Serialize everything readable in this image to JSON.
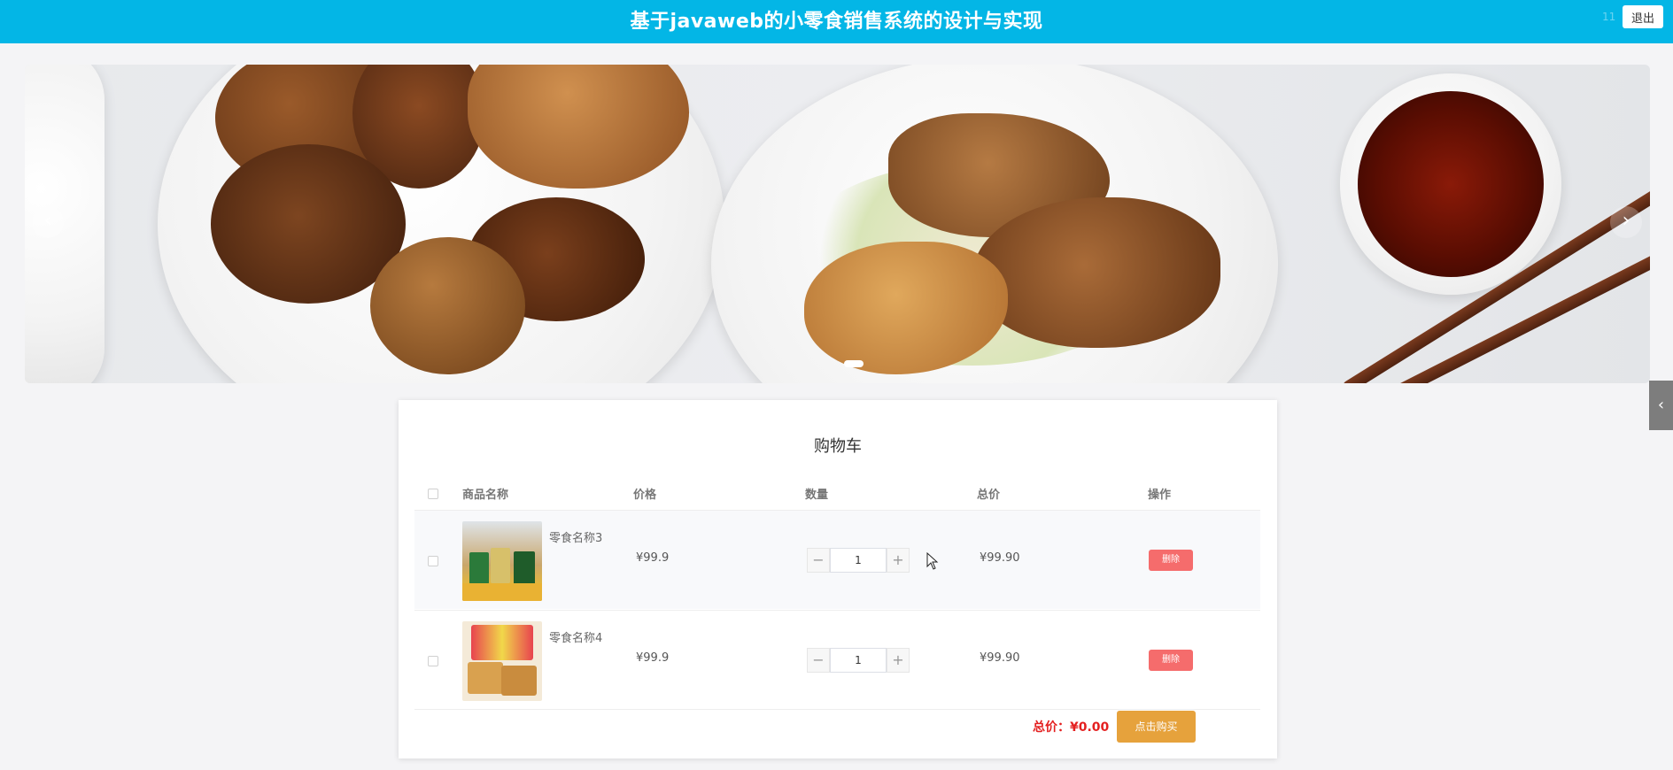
{
  "header": {
    "title": "基于javaweb的小零食销售系统的设计与实现",
    "user": "11",
    "logout_label": "退出"
  },
  "carousel": {
    "prev_icon": "‹",
    "next_icon": "›",
    "active_index": 0
  },
  "side_tab": {
    "icon": "‹"
  },
  "cart": {
    "title": "购物车",
    "columns": {
      "name": "商品名称",
      "price": "价格",
      "qty": "数量",
      "total": "总价",
      "action": "操作"
    },
    "items": [
      {
        "name": "零食名称3",
        "price": "¥99.9",
        "qty": "1",
        "subtotal": "¥99.90",
        "delete_label": "删除",
        "minus": "−",
        "plus": "+"
      },
      {
        "name": "零食名称4",
        "price": "¥99.9",
        "qty": "1",
        "subtotal": "¥99.90",
        "delete_label": "删除",
        "minus": "−",
        "plus": "+"
      }
    ],
    "total_label": "总价：¥0.00",
    "buy_label": "点击购买"
  },
  "colors": {
    "header": "#03b6e6",
    "delete": "#f56c6c",
    "buy": "#e6a23c",
    "total": "#e42020"
  }
}
